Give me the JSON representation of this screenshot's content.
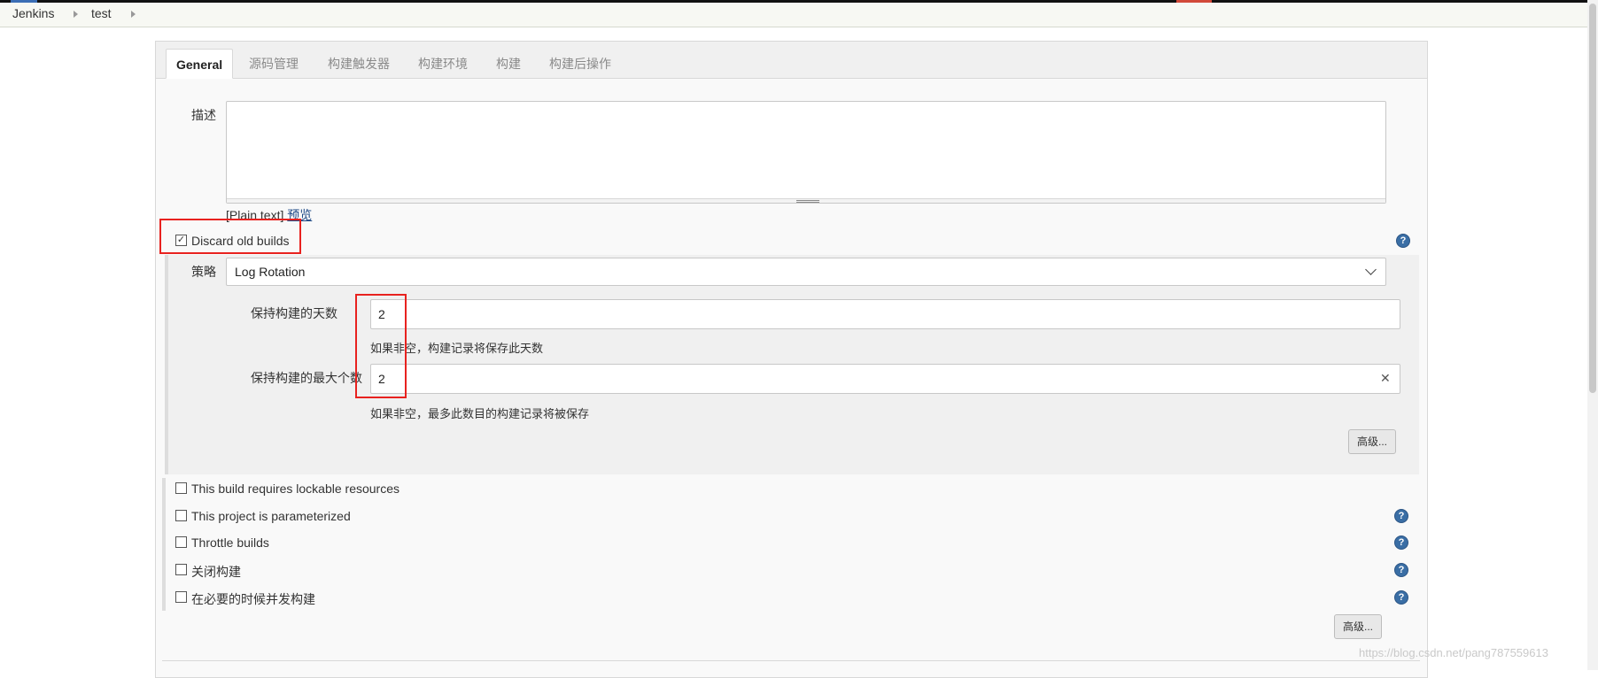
{
  "breadcrumb": {
    "items": [
      "Jenkins",
      "test"
    ]
  },
  "tabs": [
    {
      "label": "General",
      "active": true
    },
    {
      "label": "源码管理",
      "active": false
    },
    {
      "label": "构建触发器",
      "active": false
    },
    {
      "label": "构建环境",
      "active": false
    },
    {
      "label": "构建",
      "active": false
    },
    {
      "label": "构建后操作",
      "active": false
    }
  ],
  "general": {
    "description_label": "描述",
    "description_value": "",
    "plain_text": "[Plain text]",
    "preview_link": "预览",
    "discard_old_builds": {
      "label": "Discard old builds",
      "checked": true
    },
    "strategy": {
      "label": "策略",
      "selected": "Log Rotation",
      "days_label": "保持构建的天数",
      "days_value": "2",
      "days_hint": "如果非空，构建记录将保存此天数",
      "max_label": "保持构建的最大个数",
      "max_value": "2",
      "max_hint": "如果非空，最多此数目的构建记录将被保存",
      "advanced_button": "高级..."
    },
    "options": [
      {
        "label": "This build requires lockable resources",
        "checked": false,
        "help": false
      },
      {
        "label": "This project is parameterized",
        "checked": false,
        "help": true
      },
      {
        "label": "Throttle builds",
        "checked": false,
        "help": true
      },
      {
        "label": "关闭构建",
        "checked": false,
        "help": true
      },
      {
        "label": "在必要的时候并发构建",
        "checked": false,
        "help": true
      }
    ],
    "advanced_button": "高级..."
  },
  "icons": {
    "help": "question-mark-icon",
    "dropdown": "chevron-down-icon",
    "clear": "close-icon",
    "check": "checkmark-icon"
  },
  "colors": {
    "help_icon": "#3a6ea5",
    "highlight_box": "#e8221f",
    "link": "#204a87"
  },
  "watermark": "https://blog.csdn.net/pang787559613"
}
